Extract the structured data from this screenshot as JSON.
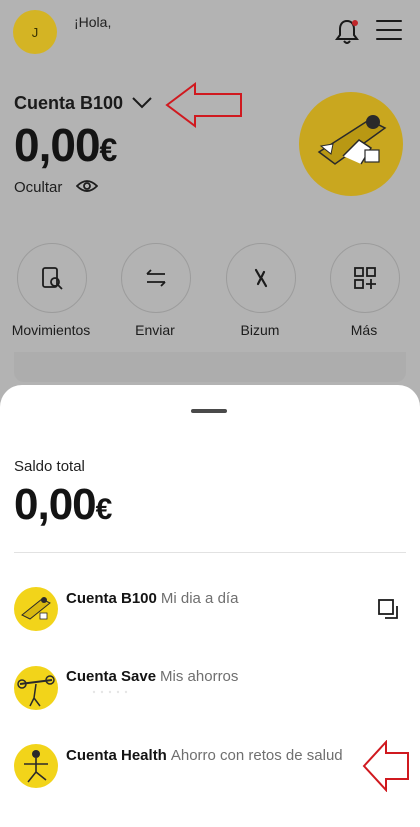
{
  "header": {
    "avatar_initial": "J",
    "greeting": "¡Hola,",
    "bell_icon": "bell-icon",
    "menu_icon": "hamburger-menu-icon"
  },
  "account": {
    "name": "Cuenta B100",
    "balance": "0,00",
    "currency": "€",
    "hide_label": "Ocultar"
  },
  "actions": [
    {
      "label": "Movimientos",
      "icon": "document-search-icon"
    },
    {
      "label": "Enviar",
      "icon": "transfer-arrows-icon"
    },
    {
      "label": "Bizum",
      "icon": "bizum-icon"
    },
    {
      "label": "Más",
      "icon": "grid-plus-icon"
    }
  ],
  "sheet": {
    "total_label": "Saldo total",
    "total_value": "0,00",
    "currency": "€",
    "accounts": [
      {
        "title": "Cuenta B100",
        "subtitle": "Mi dia a día"
      },
      {
        "title": "Cuenta Save",
        "subtitle": "Mis ahorros"
      },
      {
        "title": "Cuenta Health",
        "subtitle": "Ahorro con retos de salud"
      }
    ]
  },
  "colors": {
    "brand_yellow": "#f2d41a",
    "overlay_gray": "#b3b3b3",
    "annotation_red": "#d0191f"
  }
}
